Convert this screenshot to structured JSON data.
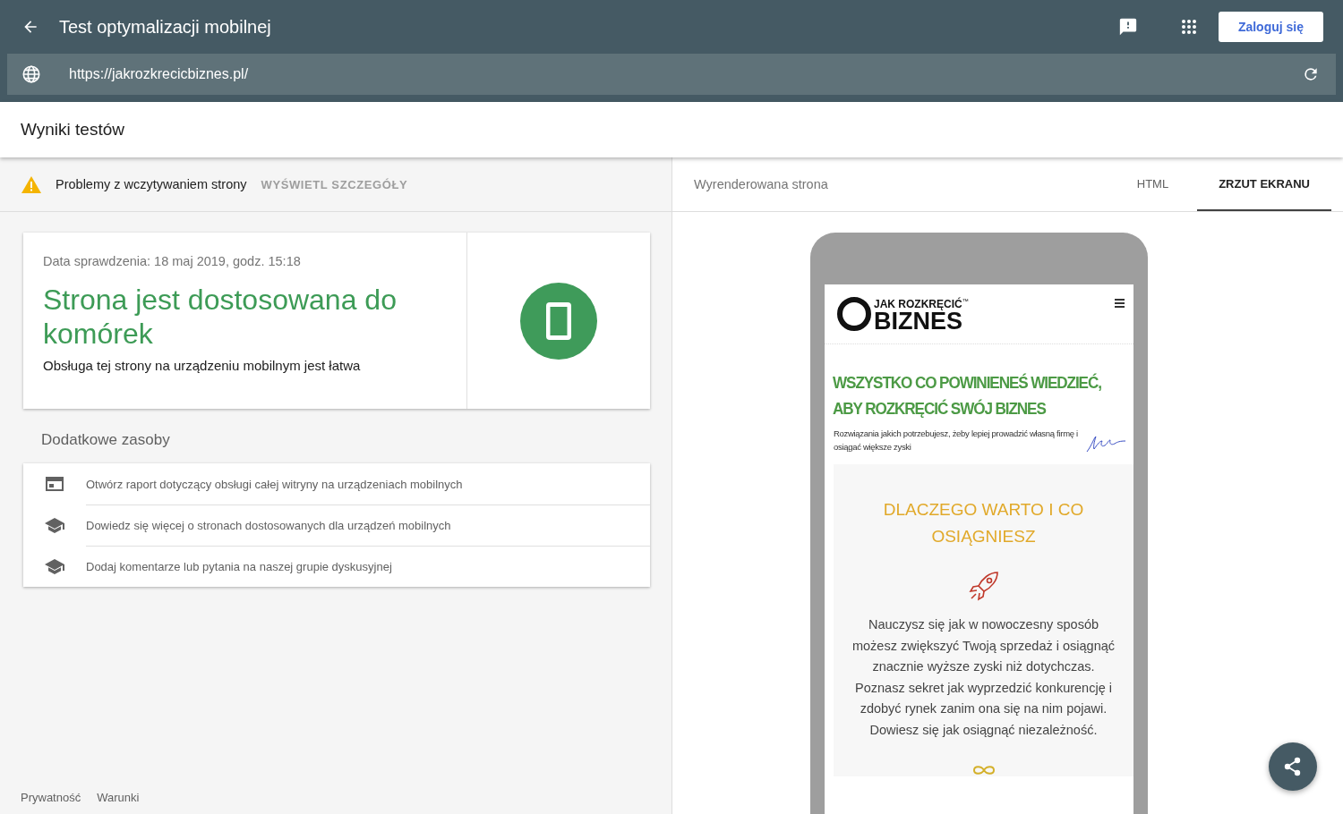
{
  "header": {
    "title": "Test optymalizacji mobilnej",
    "signin": "Zaloguj się"
  },
  "url": "https://jakrozkrecicbiznes.pl/",
  "results_title": "Wyniki testów",
  "issue": {
    "text": "Problemy z wczytywaniem strony",
    "action": "WYŚWIETL SZCZEGÓŁY"
  },
  "result": {
    "date": "Data sprawdzenia: 18 maj 2019, godz. 15:18",
    "headline": "Strona jest dostosowana do komórek",
    "description": "Obsługa tej strony na urządzeniu mobilnym jest łatwa"
  },
  "resources": {
    "title": "Dodatkowe zasoby",
    "items": [
      {
        "kind": "report",
        "label": "Otwórz raport dotyczący obsługi całej witryny na urządzeniach mobilnych"
      },
      {
        "kind": "learn",
        "label": "Dowiedz się więcej o stronach dostosowanych dla urządzeń mobilnych"
      },
      {
        "kind": "learn",
        "label": "Dodaj komentarze lub pytania na naszej grupie dyskusyjnej"
      }
    ]
  },
  "footer": [
    "Prywatność",
    "Warunki"
  ],
  "right": {
    "title": "Wyrenderowana strona",
    "tabs": [
      {
        "label": "HTML",
        "selected": false
      },
      {
        "label": "ZRZUT EKRANU",
        "selected": true
      }
    ]
  },
  "preview": {
    "logo_top": "JAK ROZKRĘCIĆ",
    "logo_mark": "™",
    "logo_main": "BIZNES",
    "headline": "WSZYSTKO CO POWINIENEŚ WIEDZIEĆ, ABY ROZKRĘCIĆ SWÓJ BIZNES",
    "tagline": "Rozwiązania jakich potrzebujesz, żeby lepiej prowadzić własną firmę i osiągać większe zyski",
    "section_title": "DLACZEGO WARTO I CO OSIĄGNIESZ",
    "body": "Nauczysz się jak w nowoczesny sposób możesz zwiększyć Twoją sprzedaż i osiągnąć znacznie wyższe zyski niż dotychczas. Poznasz sekret jak wyprzedzić konkurencję i zdobyć rynek zanim ona się na nim pojawi. Dowiesz się jak osiągnąć niezależność."
  }
}
